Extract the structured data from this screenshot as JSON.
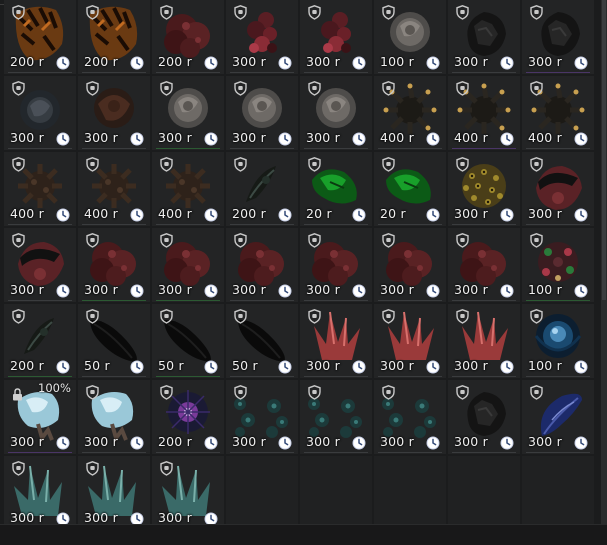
{
  "items": [
    {
      "price": "200 r",
      "art": "tiger",
      "border": ""
    },
    {
      "price": "200 r",
      "art": "tiger",
      "border": ""
    },
    {
      "price": "200 r",
      "art": "redcluster",
      "border": ""
    },
    {
      "price": "300 r",
      "art": "redflower",
      "border": ""
    },
    {
      "price": "300 r",
      "art": "redflower",
      "border": ""
    },
    {
      "price": "100 r",
      "art": "grayrose",
      "border": ""
    },
    {
      "price": "300 r",
      "art": "blackrock",
      "border": ""
    },
    {
      "price": "300 r",
      "art": "blackrock",
      "border": "p"
    },
    {
      "price": "300 r",
      "art": "darkrose",
      "border": ""
    },
    {
      "price": "300 r",
      "art": "brownrose",
      "border": ""
    },
    {
      "price": "300 r",
      "art": "grayrose",
      "border": "g"
    },
    {
      "price": "300 r",
      "art": "grayrose",
      "border": ""
    },
    {
      "price": "300 r",
      "art": "grayrose",
      "border": ""
    },
    {
      "price": "400 r",
      "art": "spike",
      "border": ""
    },
    {
      "price": "400 r",
      "art": "spike",
      "border": "p"
    },
    {
      "price": "400 r",
      "art": "spike",
      "border": ""
    },
    {
      "price": "400 r",
      "art": "spikebrown",
      "border": ""
    },
    {
      "price": "400 r",
      "art": "spikebrown",
      "border": ""
    },
    {
      "price": "400 r",
      "art": "spikebrown",
      "border": ""
    },
    {
      "price": "200 r",
      "art": "vine",
      "border": ""
    },
    {
      "price": "20 r",
      "art": "green",
      "border": ""
    },
    {
      "price": "20 r",
      "art": "green",
      "border": ""
    },
    {
      "price": "300 r",
      "art": "leopard",
      "border": ""
    },
    {
      "price": "300 r",
      "art": "redblack",
      "border": ""
    },
    {
      "price": "300 r",
      "art": "redblack",
      "border": ""
    },
    {
      "price": "300 r",
      "art": "redcluster",
      "border": "g"
    },
    {
      "price": "300 r",
      "art": "redcluster",
      "border": "g"
    },
    {
      "price": "300 r",
      "art": "redcluster",
      "border": ""
    },
    {
      "price": "300 r",
      "art": "redcluster",
      "border": ""
    },
    {
      "price": "300 r",
      "art": "redcluster",
      "border": ""
    },
    {
      "price": "300 r",
      "art": "redcluster",
      "border": ""
    },
    {
      "price": "100 r",
      "art": "multi",
      "border": "g"
    },
    {
      "price": "200 r",
      "art": "vine",
      "border": "g"
    },
    {
      "price": "50 r",
      "art": "blackleaf",
      "border": ""
    },
    {
      "price": "50 r",
      "art": "blackleaf",
      "border": "g"
    },
    {
      "price": "50 r",
      "art": "blackleaf",
      "border": ""
    },
    {
      "price": "300 r",
      "art": "redcrystal",
      "border": ""
    },
    {
      "price": "300 r",
      "art": "redcrystal",
      "border": ""
    },
    {
      "price": "300 r",
      "art": "redcrystal",
      "border": ""
    },
    {
      "price": "100 r",
      "art": "blueorb",
      "border": ""
    },
    {
      "price": "300 r",
      "art": "icecrystal",
      "border": "p",
      "locked": true,
      "percent": "100%"
    },
    {
      "price": "300 r",
      "art": "icecrystal",
      "border": ""
    },
    {
      "price": "200 r",
      "art": "starburst",
      "border": ""
    },
    {
      "price": "300 r",
      "art": "tealdots",
      "border": ""
    },
    {
      "price": "300 r",
      "art": "tealdots",
      "border": ""
    },
    {
      "price": "300 r",
      "art": "tealdots",
      "border": ""
    },
    {
      "price": "300 r",
      "art": "blackrock",
      "border": ""
    },
    {
      "price": "300 r",
      "art": "bluefeather",
      "border": ""
    },
    {
      "price": "300 r",
      "art": "mintcrystal",
      "border": ""
    },
    {
      "price": "300 r",
      "art": "mintcrystal",
      "border": ""
    },
    {
      "price": "300 r",
      "art": "mintcrystal",
      "border": ""
    }
  ],
  "empty_slots": 5
}
